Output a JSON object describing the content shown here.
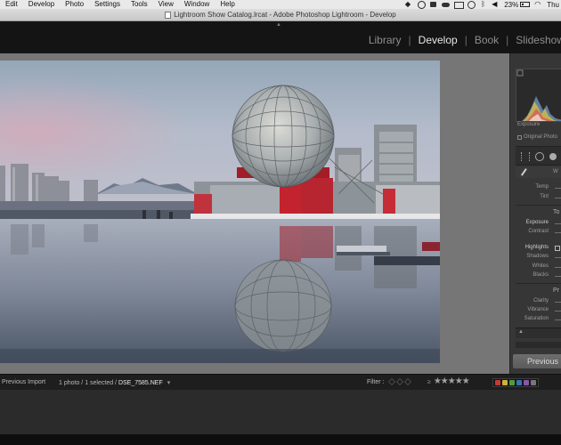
{
  "menubar": {
    "items": [
      "Edit",
      "Develop",
      "Photo",
      "Settings",
      "Tools",
      "View",
      "Window",
      "Help"
    ],
    "battery": "23%",
    "clock": "Thu"
  },
  "titlebar": {
    "title": "Lightroom Show Catalog.lrcat - Adobe Photoshop Lightroom - Develop"
  },
  "modules": {
    "items": [
      "Library",
      "Develop",
      "Book",
      "Slideshow"
    ],
    "separator": "|",
    "active": "Develop"
  },
  "right_panel": {
    "histogram_label": "Exposure",
    "original_photo": "Original Photo",
    "wb_label": "W",
    "temp": "Temp",
    "tint": "Tint",
    "tone_title": "To",
    "exposure": "Exposure",
    "contrast": "Contrast",
    "highlights": "Highlights",
    "shadows": "Shadows",
    "whites": "Whites",
    "blacks": "Blacks",
    "presence_title": "Pr",
    "clarity": "Clarity",
    "vibrance": "Vibrance",
    "saturation": "Saturation",
    "previous_button": "Previous"
  },
  "filmstrip_bar": {
    "source": "Previous Import",
    "count": "1 photo / 1 selected /",
    "filename": "DSE_7585.NEF",
    "caret": "▾",
    "filter_label": "Filter :",
    "stars_prefix": "≥",
    "stars": "★★★★★"
  },
  "colors": {
    "accent_text": "#e6e6e6",
    "label_red": "#c23a3a",
    "label_yellow": "#c9b637",
    "label_green": "#4f9b3f",
    "label_blue": "#3b6fb8",
    "label_purple": "#8a55a8"
  }
}
